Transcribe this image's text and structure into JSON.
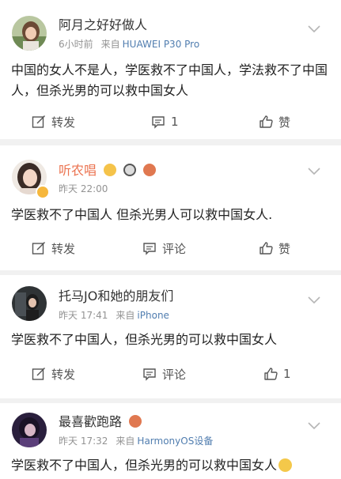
{
  "posts": [
    {
      "username": "阿月之好好做人",
      "time": "6小时前",
      "source_label": "来自",
      "source": "HUAWEI P30 Pro",
      "content": "中国的女人不是人，学医救不了中国人，学法救不了中国人，但杀光男的可以救中国女人",
      "repost_label": "转发",
      "comment_label": "1",
      "like_label": "赞"
    },
    {
      "username": "听农唱",
      "time": "昨天 22:00",
      "content": "学医救不了中国人 但杀光男人可以救中国女人.",
      "repost_label": "转发",
      "comment_label": "评论",
      "like_label": "赞"
    },
    {
      "username": "托马JO和她的朋友们",
      "time": "昨天 17:41",
      "source_label": "来自",
      "source": "iPhone",
      "content": "学医救不了中国人，但杀光男的可以救中国女人",
      "repost_label": "转发",
      "comment_label": "评论",
      "like_label": "1"
    },
    {
      "username": "最喜歡跑路",
      "time": "昨天 17:32",
      "source_label": "来自",
      "source": "HarmonyOS设备",
      "content": "学医救不了中国人，但杀光男的可以救中国女人"
    }
  ],
  "colors": {
    "username_orange": "#eb7350",
    "source_link": "#507daf",
    "meta_gray": "#939393",
    "separator": "#f1f1f1"
  },
  "icons": {
    "repost": "repost-icon",
    "comment": "comment-icon",
    "like": "like-icon",
    "more": "chevron-down-icon"
  }
}
